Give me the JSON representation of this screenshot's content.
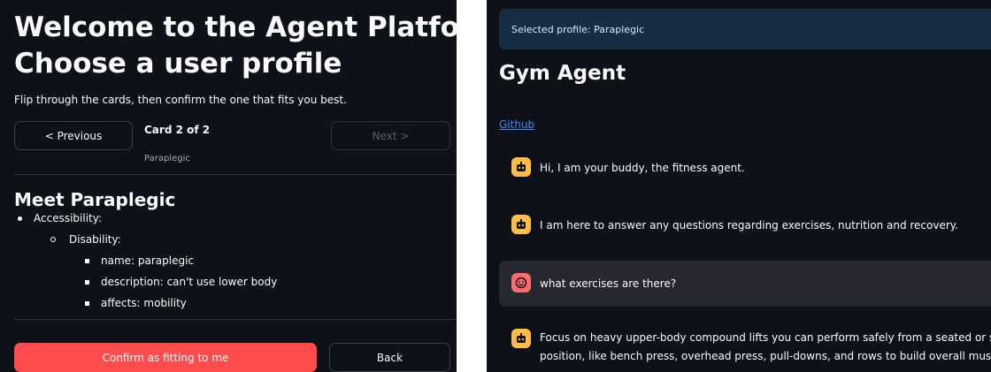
{
  "left": {
    "title_line1": "Welcome to the Agent Platform",
    "title_line2": "Choose a user profile",
    "subtitle": "Flip through the cards, then confirm the one that fits you best.",
    "prev_label": "< Previous",
    "card_counter": "Card 2 of 2",
    "card_name": "Paraplegic",
    "next_label": "Next >",
    "meet_heading": "Meet Paraplegic",
    "tree": {
      "level1": "Accessibility:",
      "level2": "Disability:",
      "items": [
        "name: paraplegic",
        "description: can't use lower body",
        "affects: mobility"
      ]
    },
    "confirm_label": "Confirm as fitting to me",
    "back_label": "Back"
  },
  "right": {
    "banner": "Selected profile: Paraplegic",
    "title": "Gym Agent",
    "github_link": "Github",
    "messages": [
      {
        "role": "assistant",
        "icon": "robot-icon",
        "text": "Hi, I am your buddy, the fitness agent."
      },
      {
        "role": "assistant",
        "icon": "robot-icon",
        "text": "I am here to answer any questions regarding exercises, nutrition and recovery."
      },
      {
        "role": "user",
        "icon": "smiley-icon",
        "text": "what exercises are there?"
      },
      {
        "role": "assistant",
        "icon": "robot-icon",
        "text_line1": "Focus on heavy upper-body compound lifts you can perform safely from a seated or supported",
        "text_line2": "position, like bench press, overhead press, pull-downs, and rows to build overall muscle mass."
      }
    ]
  },
  "colors": {
    "background": "#0e1117",
    "primary": "#ff4b4b",
    "banner": "#172d43",
    "assistant_avatar": "#ffbd45",
    "user_avatar": "#ff6b6b",
    "link": "#3d8bfd"
  }
}
